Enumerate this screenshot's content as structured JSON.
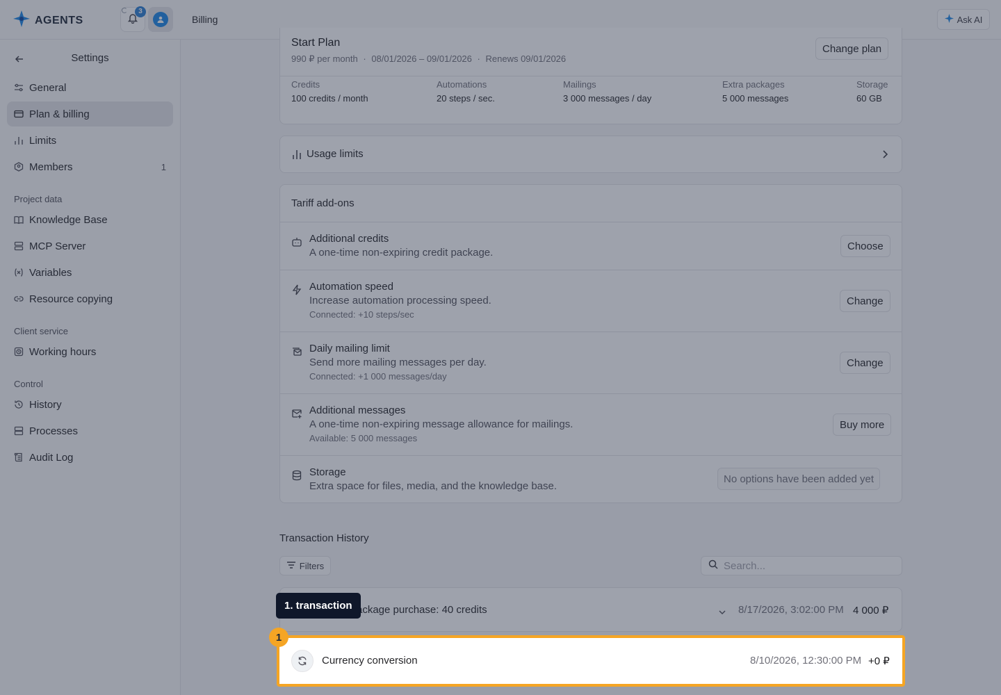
{
  "header": {
    "logo_text": "AGENTS",
    "notifications_count": "3",
    "breadcrumb": "Billing",
    "ask_ai_label": "Ask AI"
  },
  "sidebar": {
    "title": "Settings",
    "items": [
      {
        "label": "General",
        "icon": "sliders-icon"
      },
      {
        "label": "Plan & billing",
        "icon": "credit-card-icon",
        "active": true
      },
      {
        "label": "Limits",
        "icon": "bar-chart-icon"
      },
      {
        "label": "Members",
        "icon": "members-icon",
        "count": "1"
      }
    ],
    "sections": [
      {
        "label": "Project data",
        "items": [
          {
            "label": "Knowledge Base",
            "icon": "book-icon"
          },
          {
            "label": "MCP Server",
            "icon": "server-icon"
          },
          {
            "label": "Variables",
            "icon": "variable-icon"
          },
          {
            "label": "Resource copying",
            "icon": "link-icon"
          }
        ]
      },
      {
        "label": "Client service",
        "items": [
          {
            "label": "Working hours",
            "icon": "clock-icon"
          }
        ]
      },
      {
        "label": "Control",
        "items": [
          {
            "label": "History",
            "icon": "history-icon"
          },
          {
            "label": "Processes",
            "icon": "layers-icon"
          },
          {
            "label": "Audit Log",
            "icon": "scroll-icon"
          }
        ]
      }
    ]
  },
  "plan": {
    "name": "Start Plan",
    "price": "990 ₽ per month",
    "period": "08/01/2026 – 09/01/2026",
    "renews": "Renews 09/01/2026",
    "sep": "·",
    "change_plan_label": "Change plan",
    "stats": [
      {
        "label": "Credits",
        "value": "100 credits / month"
      },
      {
        "label": "Automations",
        "value": "20 steps / sec."
      },
      {
        "label": "Mailings",
        "value": "3 000 messages / day"
      },
      {
        "label": "Extra packages",
        "value": "5 000 messages"
      },
      {
        "label": "Storage",
        "value": "60 GB"
      }
    ]
  },
  "usage": {
    "label": "Usage limits"
  },
  "addons": {
    "title": "Tariff add-ons",
    "items": [
      {
        "title": "Additional credits",
        "desc": "A one-time non-expiring credit package.",
        "sub": "",
        "action": "Choose",
        "icon": "robot-icon"
      },
      {
        "title": "Automation speed",
        "desc": "Increase automation processing speed.",
        "sub": "Connected: +10 steps/sec",
        "action": "Change",
        "icon": "lightning-icon"
      },
      {
        "title": "Daily mailing limit",
        "desc": "Send more mailing messages per day.",
        "sub": "Connected: +1 000 messages/day",
        "action": "Change",
        "icon": "mail-stack-icon"
      },
      {
        "title": "Additional messages",
        "desc": "A one-time non-expiring message allowance for mailings.",
        "sub": "Available: 5 000 messages",
        "action": "Buy more",
        "icon": "mail-plus-icon"
      },
      {
        "title": "Storage",
        "desc": "Extra space for files, media, and the knowledge base.",
        "sub": "",
        "action": "No options have been added yet",
        "icon": "database-icon"
      }
    ]
  },
  "transactions": {
    "title": "Transaction History",
    "filters_label": "Filters",
    "search_placeholder": "Search...",
    "rows": [
      {
        "label": "ackage purchase: 40 credits",
        "date": "8/17/2026, 3:02:00 PM",
        "amount": "4 000 ₽"
      },
      {
        "label": "Currency conversion",
        "date": "8/10/2026, 12:30:00 PM",
        "amount": "+0 ₽"
      }
    ]
  },
  "highlight": {
    "badge": "1",
    "tooltip": "1. transaction"
  }
}
